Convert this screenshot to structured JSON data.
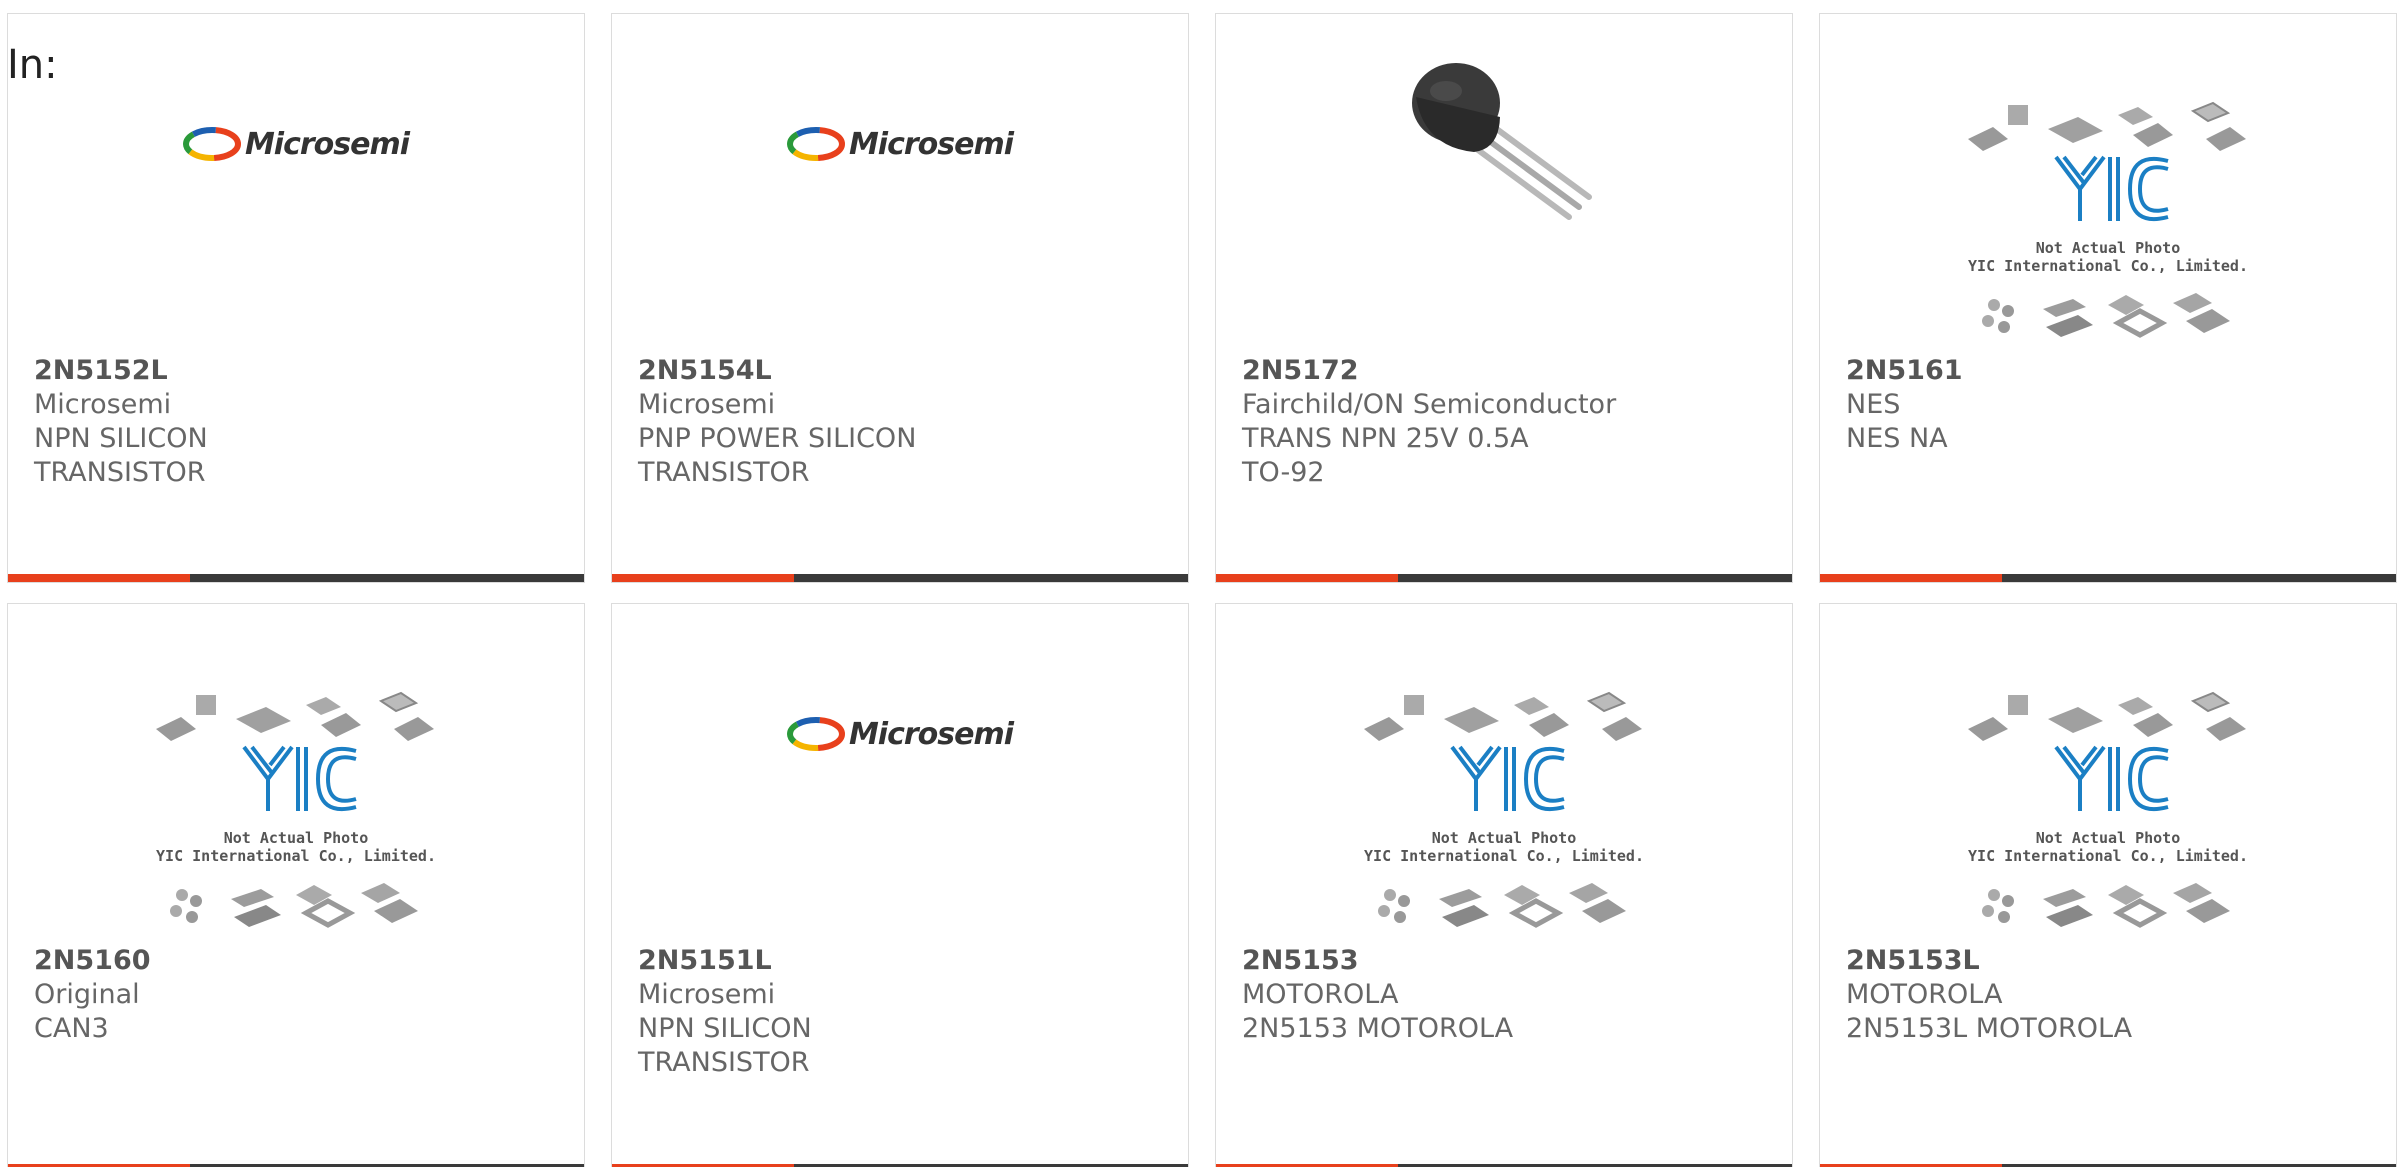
{
  "page": {
    "in_label": "In:"
  },
  "products": [
    {
      "part": "2N5152L",
      "manufacturer": "Microsemi",
      "description": "NPN SILICON TRANSISTOR",
      "image": "microsemi-logo"
    },
    {
      "part": "2N5154L",
      "manufacturer": "Microsemi",
      "description": "PNP POWER SILICON TRANSISTOR",
      "image": "microsemi-logo"
    },
    {
      "part": "2N5172",
      "manufacturer": "Fairchild/ON Semiconductor",
      "description": "TRANS NPN 25V 0.5A TO-92",
      "image": "to92-transistor-photo"
    },
    {
      "part": "2N5161",
      "manufacturer": "NES",
      "description": "NES NA",
      "image": "yic-placeholder"
    },
    {
      "part": "2N5160",
      "manufacturer": "Original",
      "description": "CAN3",
      "image": "yic-placeholder"
    },
    {
      "part": "2N5151L",
      "manufacturer": "Microsemi",
      "description": "NPN SILICON TRANSISTOR",
      "image": "microsemi-logo"
    },
    {
      "part": "2N5153",
      "manufacturer": "MOTOROLA",
      "description": "2N5153 MOTOROLA",
      "image": "yic-placeholder"
    },
    {
      "part": "2N5153L",
      "manufacturer": "MOTOROLA",
      "description": "2N5153L MOTOROLA",
      "image": "yic-placeholder"
    }
  ],
  "logos": {
    "microsemi_text": "Microsemi",
    "yic_line1": "Not Actual Photo",
    "yic_line2": "YIC International Co., Limited."
  },
  "colors": {
    "accent": "#e8401c",
    "bar": "#3a3a3a",
    "text": "#666666",
    "yic_blue": "#1b7fc4"
  }
}
